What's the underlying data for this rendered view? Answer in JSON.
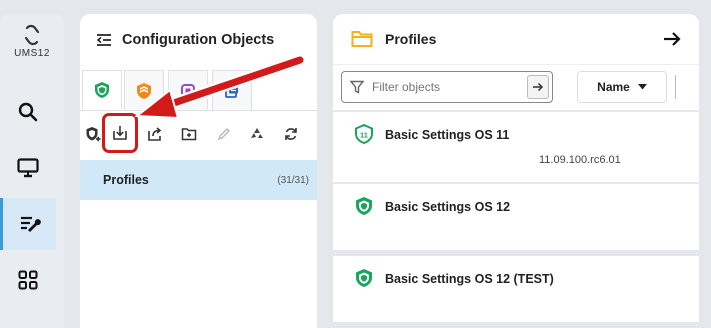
{
  "app": {
    "logo_text": "UMS12"
  },
  "nav": {
    "items": [
      {
        "name": "search",
        "icon": "search-icon"
      },
      {
        "name": "devices",
        "icon": "monitor-icon"
      },
      {
        "name": "configuration",
        "icon": "config-tools-icon",
        "active": true
      },
      {
        "name": "apps",
        "icon": "apps-grid-icon"
      }
    ]
  },
  "config_panel": {
    "title": "Configuration Objects",
    "tabs": [
      {
        "name": "profiles",
        "icon": "shield-icon",
        "color": "#1aa55c",
        "active": true
      },
      {
        "name": "priority-profiles",
        "icon": "priority-shield-icon",
        "color": "#f08a12"
      },
      {
        "name": "firmware",
        "icon": "firmware-icon",
        "color": "#a144c7"
      },
      {
        "name": "templates",
        "icon": "template-icon",
        "color": "#2d5bd9"
      }
    ],
    "toolbar": [
      {
        "name": "new-profile",
        "icon": "new-profile-icon"
      },
      {
        "name": "import",
        "icon": "import-icon",
        "highlighted": true
      },
      {
        "name": "export",
        "icon": "export-icon"
      },
      {
        "name": "new-folder",
        "icon": "new-folder-icon"
      },
      {
        "name": "edit",
        "icon": "pencil-icon",
        "disabled": true
      },
      {
        "name": "recycle",
        "icon": "recycle-icon"
      },
      {
        "name": "refresh",
        "icon": "refresh-icon"
      }
    ],
    "tree": [
      {
        "label": "Profiles",
        "count": "(31/31)",
        "selected": true
      }
    ]
  },
  "profiles_panel": {
    "title": "Profiles",
    "search": {
      "placeholder": "Filter objects",
      "value": ""
    },
    "sort": {
      "label": "Name"
    },
    "items": [
      {
        "title": "Basic Settings OS 11",
        "subtitle": "11.09.100.rc6.01",
        "icon": "shield-11-icon"
      },
      {
        "title": "Basic Settings OS 12",
        "subtitle": "",
        "icon": "shield-icon"
      },
      {
        "title": "Basic Settings OS 12 (TEST)",
        "subtitle": "",
        "icon": "shield-icon"
      }
    ]
  },
  "colors": {
    "accent": "#3a9bd9",
    "highlight": "#d21a1a",
    "selected_bg": "#d0e8f8"
  }
}
